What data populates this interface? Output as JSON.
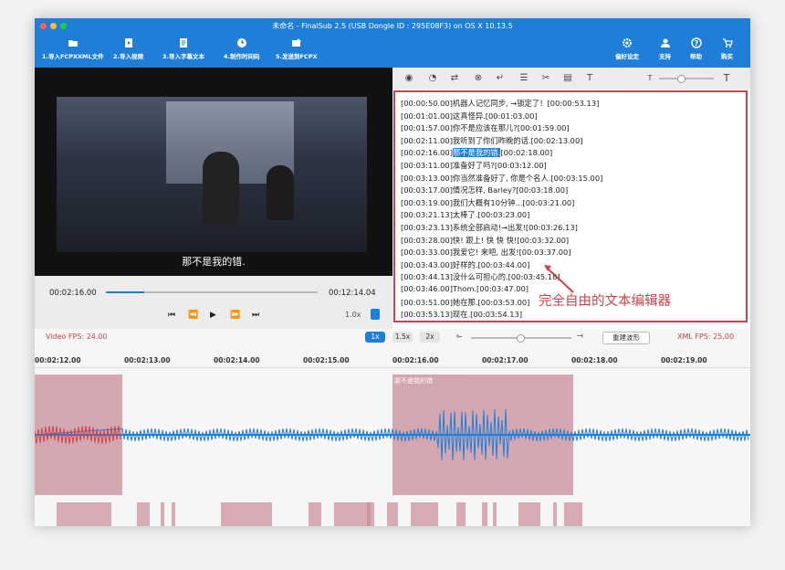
{
  "app": {
    "title": "未命名 - FinalSub 2.5 (USB Dongle ID : 295E08F3) on OS X 10.13.5"
  },
  "toolbar": {
    "import_fcpxml": "1.导入FCPXXML文件",
    "import_video": "2.导入视频",
    "import_subtitle": "3.导入字幕文本",
    "make_timecode": "4.制作时间码",
    "send_fcpx": "5.发送到FCPX",
    "preferences": "偏好设定",
    "support": "支持",
    "help": "帮助",
    "buy": "购买"
  },
  "player": {
    "subtitle": "那不是我的错.",
    "current_time": "00:02:16.00",
    "total_time": "00:12:14.04",
    "progress": 0.18,
    "speed": "1.0x"
  },
  "editor": {
    "lines": [
      "[00:00:50.00]机器人记忆同步, →锁定了！[00:00:53.13]",
      "[00:01:01.00]这真怪异.[00:01:03.00]",
      "[00:01:57.00]你不是应该在那儿?[00:01:59.00]",
      "[00:02:11.00]我听到了你们昨晚的话.[00:02:13.00]",
      "[00:02:16.00]那不是我的错.[00:02:18.00]",
      "[00:03:11.00]准备好了吗?[00:03:12.00]",
      "[00:03:13.00]你当然准备好了, 你是个名人.[00:03:15.00]",
      "[00:03:17.00]情况怎样, Barley?[00:03:18.00]",
      "[00:03:19.00]我们大概有10分钟...[00:03:21.00]",
      "[00:03:21.13]太棒了.[00:03:23.00]",
      "[00:03:23.13]系统全部启动!→出发![00:03:26.13]",
      "[00:03:28.00]快! 跟上! 快 快 快![00:03:32.00]",
      "[00:03:33.00]我爱它! 来吧, 出发![00:03:37.00]",
      "[00:03:43.00]好样的.[00:03:44.00]",
      "[00:03:44.13]没什么可担心的.[00:03:45.18]",
      "[00:03:46.00]Thom.[00:03:47.00]",
      "[00:03:51.00]她在那.[00:03:53.00]",
      "[00:03:53.13]现在.[00:03:54.13]"
    ],
    "highlight": "那不是我的错.",
    "annotation": "完全自由的文本编辑器"
  },
  "timeline": {
    "video_fps": "Video FPS: 24.00",
    "xml_fps": "XML FPS: 25.00",
    "speed_options": [
      "1x",
      "1.5x",
      "2x"
    ],
    "rebuild_wave": "重建波形",
    "ticks": [
      "00:02:12.00",
      "00:02:13.00",
      "00:02:14.00",
      "00:02:15.00",
      "00:02:16.00",
      "00:02:17.00",
      "00:02:18.00",
      "00:02:19.00"
    ],
    "segment_label": "那不是我的错"
  },
  "colors": {
    "accent": "#1f7fd8",
    "highlight": "#c9434e",
    "segment": "#c98c98"
  }
}
